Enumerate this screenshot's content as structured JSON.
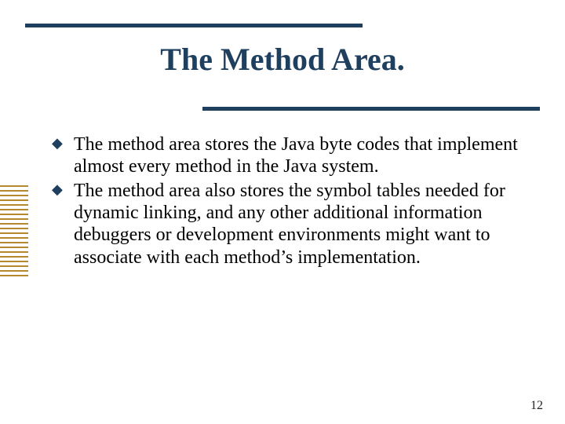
{
  "title": "The Method Area.",
  "bullets": [
    "The method area stores the Java byte codes that implement almost every method in the Java system.",
    "The method area also stores the symbol tables needed for dynamic linking, and any other additional information debuggers or development environments might want to associate with each method’s implementation."
  ],
  "page_number": "12"
}
